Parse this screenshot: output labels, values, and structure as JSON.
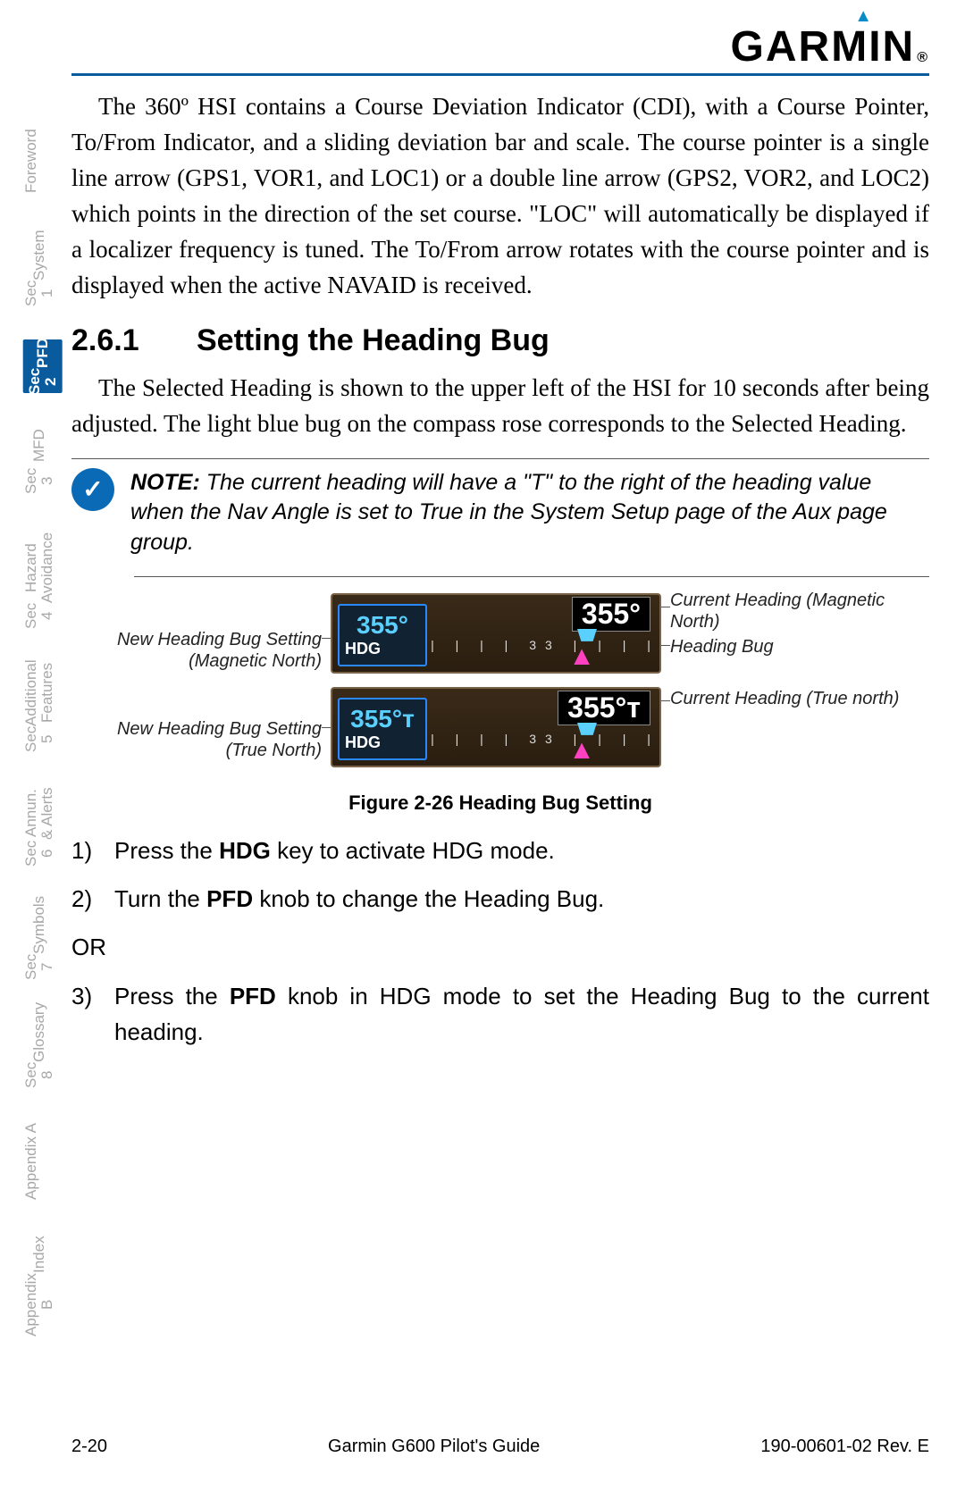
{
  "brand": "GARMIN",
  "sidetabs": [
    {
      "l1": "",
      "l2": "Foreword"
    },
    {
      "l1": "Sec 1",
      "l2": "System"
    },
    {
      "l1": "Sec 2",
      "l2": "PFD"
    },
    {
      "l1": "Sec 3",
      "l2": "MFD"
    },
    {
      "l1": "Sec 4",
      "l2": "Hazard Avoidance"
    },
    {
      "l1": "Sec 5",
      "l2": "Additional Features"
    },
    {
      "l1": "Sec 6",
      "l2": "Annun. & Alerts"
    },
    {
      "l1": "Sec 7",
      "l2": "Symbols"
    },
    {
      "l1": "Sec 8",
      "l2": "Glossary"
    },
    {
      "l1": "",
      "l2": "Appendix A"
    },
    {
      "l1": "Appendix B",
      "l2": "Index"
    }
  ],
  "para1": "The 360º HSI contains a Course Deviation Indicator (CDI), with a Course Pointer, To/From Indicator, and a sliding deviation bar and scale. The course pointer is a single line arrow (GPS1, VOR1, and LOC1) or a double line arrow (GPS2, VOR2, and LOC2) which points in the direction of the set course. \"LOC\" will automatically be displayed if a localizer frequency is tuned. The To/From arrow rotates with the course pointer and is displayed when the active NAVAID is received.",
  "heading": {
    "num": "2.6.1",
    "title": "Setting the Heading Bug"
  },
  "para2": "The Selected Heading is shown to the upper left of the HSI for 10 seconds after being adjusted. The light blue bug on the compass rose corresponds to the Selected Heading.",
  "note": {
    "label": "NOTE:",
    "text": " The current heading will have a \"T\" to the right of the heading value when the Nav Angle is set to True in the System Setup page of the Aux page group."
  },
  "callouts": {
    "left1": "New Heading Bug Setting (Magnetic North)",
    "left2": "New Heading Bug Setting (True North)",
    "right1": "Current Heading (Magnetic North)",
    "right2": "Heading Bug",
    "right3": "Current Heading (True north)"
  },
  "display": {
    "mag": {
      "hdg_val": "355°",
      "hdg_lbl": "HDG",
      "readout": "355°"
    },
    "true": {
      "hdg_val": "355°ᴛ",
      "hdg_lbl": "HDG",
      "readout": "355°ᴛ"
    },
    "ticks": "| | | | 33 | | | |"
  },
  "figure_caption": "Figure 2-26  Heading Bug Setting",
  "steps": {
    "s1_n": "1)",
    "s1_pre": "Press the ",
    "s1_b": "HDG",
    "s1_post": " key to activate HDG mode.",
    "s2_n": "2)",
    "s2_pre": "Turn the ",
    "s2_b": "PFD",
    "s2_post": " knob to change the Heading Bug.",
    "or": "OR",
    "s3_n": "3)",
    "s3_pre": "Press the ",
    "s3_b": "PFD",
    "s3_post": " knob in HDG mode to set the Heading Bug to the current heading."
  },
  "footer": {
    "page": "2-20",
    "title": "Garmin G600 Pilot's Guide",
    "doc": "190-00601-02  Rev. E"
  }
}
